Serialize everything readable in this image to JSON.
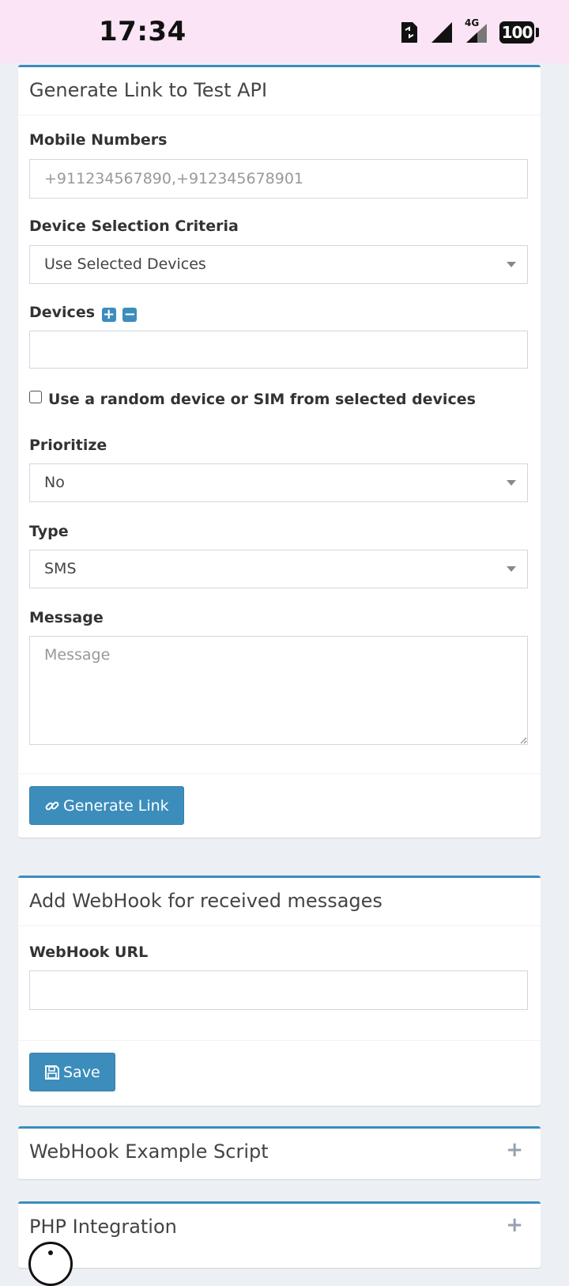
{
  "status_bar": {
    "time": "17:34",
    "network_label": "4G",
    "battery": "100"
  },
  "test_api": {
    "title": "Generate Link to Test API",
    "mobile_numbers_label": "Mobile Numbers",
    "mobile_numbers_placeholder": "+911234567890,+912345678901",
    "device_criteria_label": "Device Selection Criteria",
    "device_criteria_value": "Use Selected Devices",
    "devices_label": "Devices",
    "random_device_label": "Use a random device or SIM from selected devices",
    "prioritize_label": "Prioritize",
    "prioritize_value": "No",
    "type_label": "Type",
    "type_value": "SMS",
    "message_label": "Message",
    "message_placeholder": "Message",
    "generate_button": "Generate Link"
  },
  "webhook": {
    "title": "Add WebHook for received messages",
    "url_label": "WebHook URL",
    "save_button": "Save"
  },
  "webhook_example": {
    "title": "WebHook Example Script"
  },
  "php_integration": {
    "title": "PHP Integration"
  },
  "colors": {
    "accent": "#3c8dbc",
    "background": "#ecf0f5",
    "status_bar": "#fbe4f5"
  }
}
